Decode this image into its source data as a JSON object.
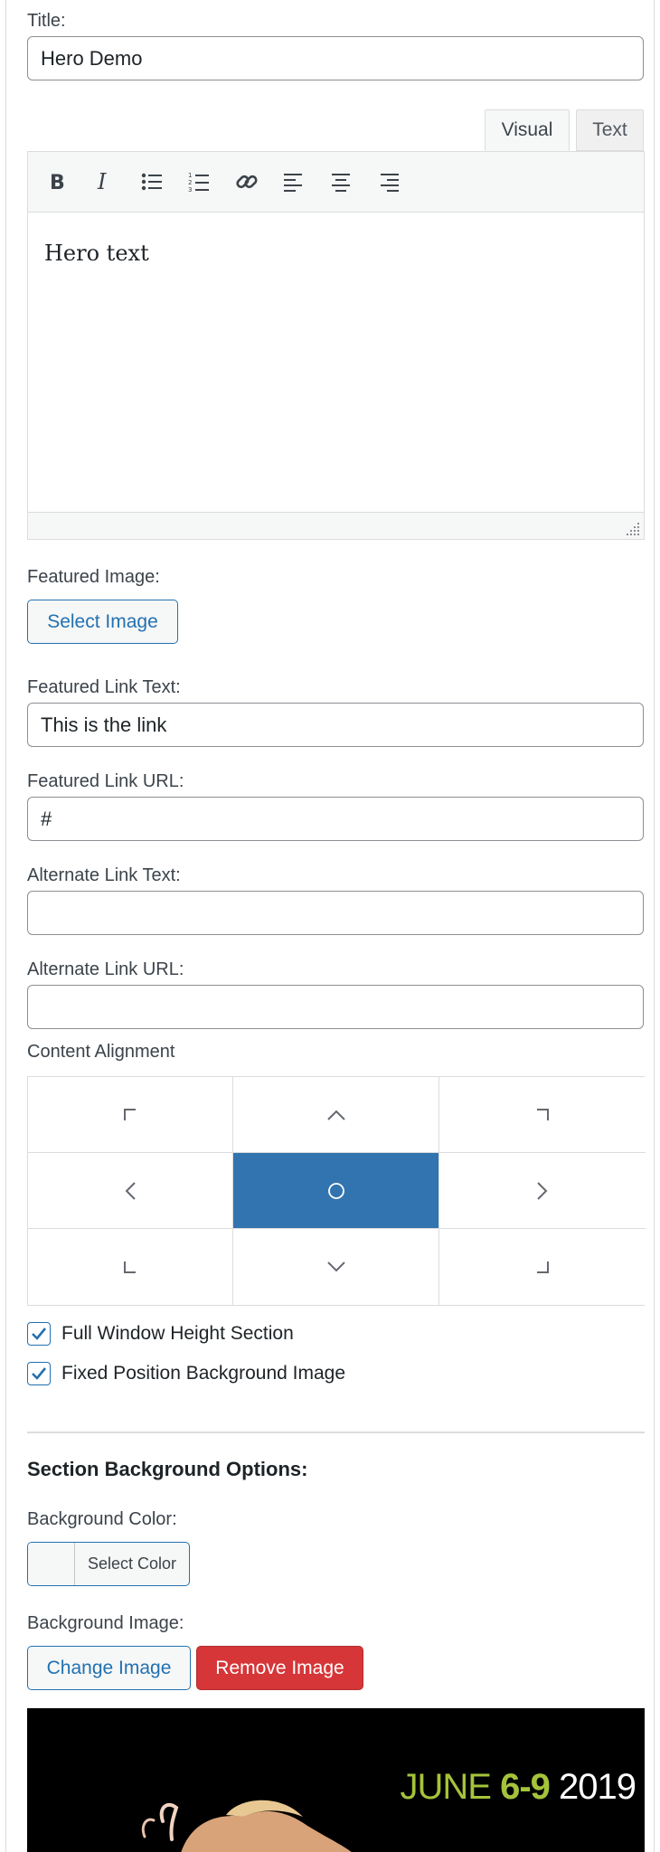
{
  "title_field": {
    "label": "Title:",
    "value": "Hero Demo"
  },
  "editor": {
    "tabs": [
      {
        "label": "Visual"
      },
      {
        "label": "Text"
      }
    ],
    "toolbar_icons": [
      "bold-icon",
      "italic-icon",
      "bulleted-list-icon",
      "numbered-list-icon",
      "link-icon",
      "align-left-icon",
      "align-center-icon",
      "align-right-icon"
    ],
    "content": "Hero text"
  },
  "featured_image": {
    "label": "Featured Image:",
    "button": "Select Image"
  },
  "featured_link_text": {
    "label": "Featured Link Text:",
    "value": "This is the link"
  },
  "featured_link_url": {
    "label": "Featured Link URL:",
    "value": "#"
  },
  "alternate_link_text": {
    "label": "Alternate Link Text:",
    "value": ""
  },
  "alternate_link_url": {
    "label": "Alternate Link URL:",
    "value": ""
  },
  "content_alignment": {
    "label": "Content Alignment",
    "options": [
      "top-left",
      "top-center",
      "top-right",
      "middle-left",
      "center",
      "middle-right",
      "bottom-left",
      "bottom-center",
      "bottom-right"
    ],
    "selected": "center"
  },
  "checkboxes": [
    {
      "label": "Full Window Height Section",
      "checked": true
    },
    {
      "label": "Fixed Position Background Image",
      "checked": true
    }
  ],
  "background_section": {
    "heading": "Section Background Options:",
    "color_label": "Background Color:",
    "color_button": "Select Color",
    "image_label": "Background Image:",
    "change_button": "Change Image",
    "remove_button": "Remove Image",
    "preview_date": {
      "month": "JUNE",
      "days": "6-9",
      "year": "2019"
    }
  },
  "colors": {
    "accent": "#2271b1",
    "selected_cell": "#3274af",
    "danger": "#d63638",
    "banner_green": "#a5c33a"
  }
}
